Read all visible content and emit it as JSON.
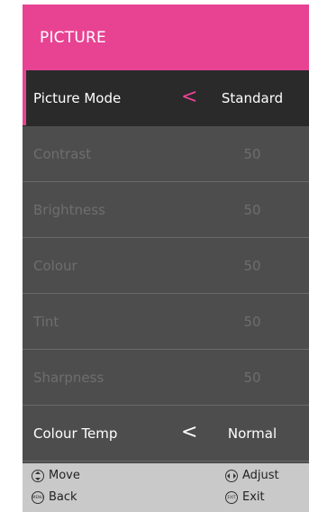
{
  "header": {
    "title": "PICTURE"
  },
  "colors": {
    "accent": "#e84393",
    "panel": "#4d4d4d",
    "selected_row": "#2a2a2a",
    "footer": "#c9c9c9"
  },
  "rows": [
    {
      "label": "Picture Mode",
      "value": "Standard",
      "chevron": "<"
    },
    {
      "label": "Contrast",
      "value": "50"
    },
    {
      "label": "Brightness",
      "value": "50"
    },
    {
      "label": "Colour",
      "value": "50"
    },
    {
      "label": "Tint",
      "value": "50"
    },
    {
      "label": "Sharpness",
      "value": "50"
    },
    {
      "label": "Colour Temp",
      "value": "Normal",
      "chevron": "<"
    }
  ],
  "footer": {
    "move": {
      "label": "Move",
      "icon": "up-down-icon"
    },
    "adjust": {
      "label": "Adjust",
      "icon": "left-right-icon"
    },
    "back": {
      "label": "Back",
      "icon": "menu-button-icon",
      "icon_text": "MENU"
    },
    "exit": {
      "label": "Exit",
      "icon": "exit-button-icon",
      "icon_text": "EXIT"
    }
  }
}
